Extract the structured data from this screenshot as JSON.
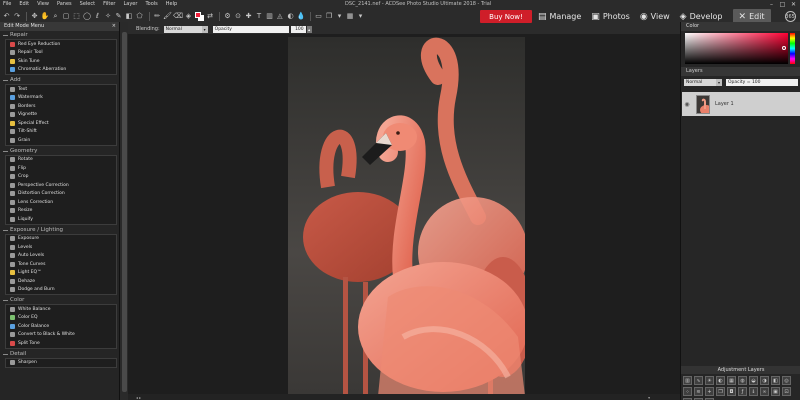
{
  "app_title": "DSC_2141.nef - ACDSee Photo Studio Ultimate 2018 - Trial",
  "menu": [
    "File",
    "Edit",
    "View",
    "Panes",
    "Select",
    "Filter",
    "Layer",
    "Tools",
    "Help"
  ],
  "window_controls": {
    "minimize": "–",
    "maximize": "□",
    "close": "✕"
  },
  "colors": {
    "foreground": "#f11f3b",
    "background": "#ffffff",
    "buy": "#cf1e29"
  },
  "buy": {
    "label": "Buy Now!",
    "tooltip": "Buy Now!"
  },
  "modes": [
    {
      "label": "Manage",
      "icon": "manage-icon"
    },
    {
      "label": "Photos",
      "icon": "photos-icon"
    },
    {
      "label": "View",
      "icon": "view-icon"
    },
    {
      "label": "Develop",
      "icon": "develop-icon"
    },
    {
      "label": "Edit",
      "icon": "edit-icon"
    }
  ],
  "mode_extras": {
    "badge1": "365",
    "badge2": "ⓘ"
  },
  "options": {
    "blending_label": "Blending:",
    "blending_value": "Normal",
    "opacity_label": "Opacity",
    "opacity_value": "100"
  },
  "left_panel": {
    "title": "Edit Mode Menu",
    "groups": [
      {
        "title": "Repair",
        "items": [
          "Red Eye Reduction",
          "Repair Tool",
          "Skin Tune",
          "Chromatic Aberration"
        ]
      },
      {
        "title": "Add",
        "items": [
          "Text",
          "Watermark",
          "Borders",
          "Vignette",
          "Special Effect",
          "Tilt-Shift",
          "Grain"
        ]
      },
      {
        "title": "Geometry",
        "items": [
          "Rotate",
          "Flip",
          "Crop",
          "Perspective Correction",
          "Distortion Correction",
          "Lens Correction",
          "Resize",
          "Liquify"
        ]
      },
      {
        "title": "Exposure / Lighting",
        "items": [
          "Exposure",
          "Levels",
          "Auto Levels",
          "Tone Curves",
          "Light EQ™",
          "Dehaze",
          "Dodge and Burn"
        ]
      },
      {
        "title": "Color",
        "items": [
          "White Balance",
          "Color EQ",
          "Color Balance",
          "Convert to Black & White",
          "Split Tone"
        ]
      },
      {
        "title": "Detail",
        "items": [
          "Sharpen"
        ]
      }
    ]
  },
  "right_panel": {
    "color_title": "Color",
    "layers_title": "Layers",
    "layer_blend": "Normal",
    "layer_opacity": "Opacity = 100",
    "layer_name": "Layer 1",
    "adjustment_title": "Adjustment Layers"
  }
}
